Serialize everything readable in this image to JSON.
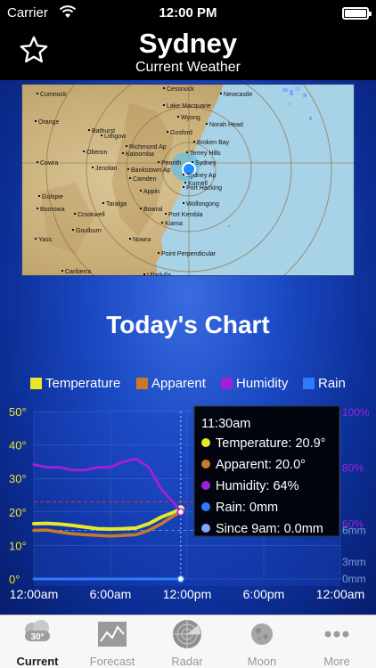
{
  "status_bar": {
    "carrier": "Carrier",
    "time": "12:00 PM"
  },
  "header": {
    "title": "Sydney",
    "subtitle": "Current Weather",
    "favorite_icon": "star-icon"
  },
  "radar_map": {
    "places": [
      {
        "name": "Cumnock"
      },
      {
        "name": "Cessnock"
      },
      {
        "name": "Newcastle"
      },
      {
        "name": "Orange"
      },
      {
        "name": "Lake Macquarie"
      },
      {
        "name": "Bathurst"
      },
      {
        "name": "Lithgow"
      },
      {
        "name": "Wyong"
      },
      {
        "name": "Norah Head"
      },
      {
        "name": "Gosford"
      },
      {
        "name": "Broken Bay"
      },
      {
        "name": "Richmond Ap"
      },
      {
        "name": "Katoomba"
      },
      {
        "name": "Terrey Hills"
      },
      {
        "name": "Oberon"
      },
      {
        "name": "Penrith"
      },
      {
        "name": "Sydney"
      },
      {
        "name": "Cowra"
      },
      {
        "name": "Jenolan"
      },
      {
        "name": "Bankstown Ap"
      },
      {
        "name": "Camden"
      },
      {
        "name": "Sydney Ap"
      },
      {
        "name": "Kurnell"
      },
      {
        "name": "Port Hacking"
      },
      {
        "name": "Appin"
      },
      {
        "name": "Gulspie"
      },
      {
        "name": "Taralga"
      },
      {
        "name": "Wollongong"
      },
      {
        "name": "Boorowa"
      },
      {
        "name": "Crookwell"
      },
      {
        "name": "Bowral"
      },
      {
        "name": "Port Kembla"
      },
      {
        "name": "Kiama"
      },
      {
        "name": "Goulburn"
      },
      {
        "name": "Yass"
      },
      {
        "name": "Nowra"
      },
      {
        "name": "Point Perpendicular"
      },
      {
        "name": "Canberra"
      },
      {
        "name": "Ulladulla"
      }
    ]
  },
  "chart_section": {
    "title": "Today's Chart",
    "legend": [
      {
        "label": "Temperature",
        "color": "#e8e82a"
      },
      {
        "label": "Apparent",
        "color": "#c87a28"
      },
      {
        "label": "Humidity",
        "color": "#a020d8"
      },
      {
        "label": "Rain",
        "color": "#2f7bff"
      }
    ],
    "tooltip": {
      "time": "11:30am",
      "rows": [
        {
          "label": "Temperature: 20.9°",
          "color": "#e8e82a"
        },
        {
          "label": "Apparent: 20.0°",
          "color": "#c87a28"
        },
        {
          "label": "Humidity: 64%",
          "color": "#a020d8"
        },
        {
          "label": "Rain: 0mm",
          "color": "#2f7bff"
        },
        {
          "label": "Since 9am: 0.0mm",
          "color": "#7fa8ff"
        }
      ]
    }
  },
  "chart_data": {
    "type": "line",
    "x_ticks": [
      "12:00am",
      "6:00am",
      "12:00pm",
      "6:00pm",
      "12:00am"
    ],
    "y_left_ticks": [
      "0°",
      "10°",
      "20°",
      "30°",
      "40°",
      "50°"
    ],
    "y_left_range": [
      0,
      50
    ],
    "y_right_humidity_ticks": [
      "100%",
      "80%",
      "60%"
    ],
    "y_right_rain_ticks": [
      "6mm",
      "3mm",
      "0mm"
    ],
    "x_range_hours": [
      0,
      24
    ],
    "series": [
      {
        "name": "Temperature",
        "color": "#e8e82a",
        "x_hours": [
          0,
          1,
          2,
          3,
          4,
          5,
          6,
          7,
          8,
          9,
          10,
          11,
          11.5
        ],
        "values": [
          16.5,
          16.6,
          16.4,
          16.0,
          15.5,
          15.0,
          14.9,
          15.0,
          15.2,
          16.5,
          18.5,
          20.0,
          20.9
        ]
      },
      {
        "name": "Apparent",
        "color": "#c87a28",
        "x_hours": [
          0,
          1,
          2,
          3,
          4,
          5,
          6,
          7,
          8,
          9,
          10,
          11,
          11.5
        ],
        "values": [
          14.5,
          14.6,
          14.0,
          13.5,
          13.2,
          13.0,
          12.8,
          13.0,
          13.2,
          14.5,
          16.5,
          19.0,
          20.0
        ]
      },
      {
        "name": "Humidity",
        "color": "#a020d8",
        "x_hours": [
          0,
          1,
          2,
          3,
          4,
          5,
          6,
          7,
          8,
          9,
          10,
          11,
          11.5
        ],
        "values": [
          81,
          80,
          80,
          79,
          79,
          80,
          80,
          82,
          83,
          80,
          72,
          67,
          64
        ]
      },
      {
        "name": "Rain",
        "color": "#2f7bff",
        "x_hours": [
          0,
          11.5
        ],
        "values": [
          0,
          0
        ]
      }
    ],
    "reference_lines": {
      "temperature_forecast_max": 23,
      "temperature_forecast_min": 14.5
    },
    "current_time_hours": 11.5
  },
  "tabs": [
    {
      "label": "Current",
      "icon": "cloud-30-icon",
      "active": true
    },
    {
      "label": "Forecast",
      "icon": "trend-chart-icon",
      "active": false
    },
    {
      "label": "Radar",
      "icon": "radar-icon",
      "active": false
    },
    {
      "label": "Moon",
      "icon": "moon-icon",
      "active": false
    },
    {
      "label": "More",
      "icon": "more-dots-icon",
      "active": false
    }
  ]
}
